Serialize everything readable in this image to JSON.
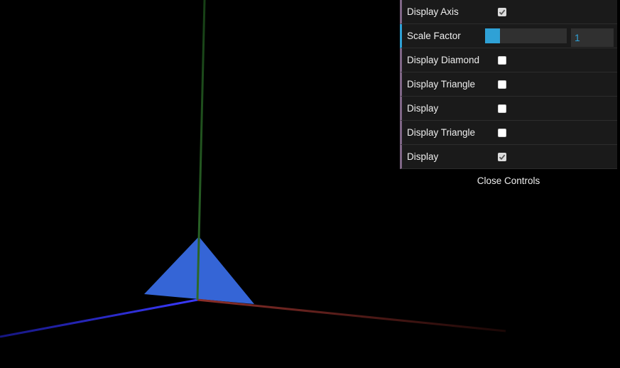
{
  "scene": {
    "colors": {
      "background": "#000000",
      "x_axis": "#8b2f2a",
      "y_axis": "#2e6b2a",
      "z_axis": "#2f2fe8",
      "shape": "#3565d6"
    }
  },
  "controls": {
    "rows": [
      {
        "label": "Display Axis",
        "type": "checkbox",
        "checked": true
      },
      {
        "label": "Scale Factor",
        "type": "number",
        "value": "1",
        "fill_fraction": 0.18
      },
      {
        "label": "Display Diamond",
        "type": "checkbox",
        "checked": false
      },
      {
        "label": "Display Triangle",
        "type": "checkbox",
        "checked": false
      },
      {
        "label": "Display",
        "type": "checkbox",
        "checked": false
      },
      {
        "label": "Display Triangle",
        "type": "checkbox",
        "checked": false
      },
      {
        "label": "Display",
        "type": "checkbox",
        "checked": true
      }
    ],
    "close_label": "Close Controls",
    "accent": "#2fa1d6",
    "row_marker": "#806787"
  }
}
